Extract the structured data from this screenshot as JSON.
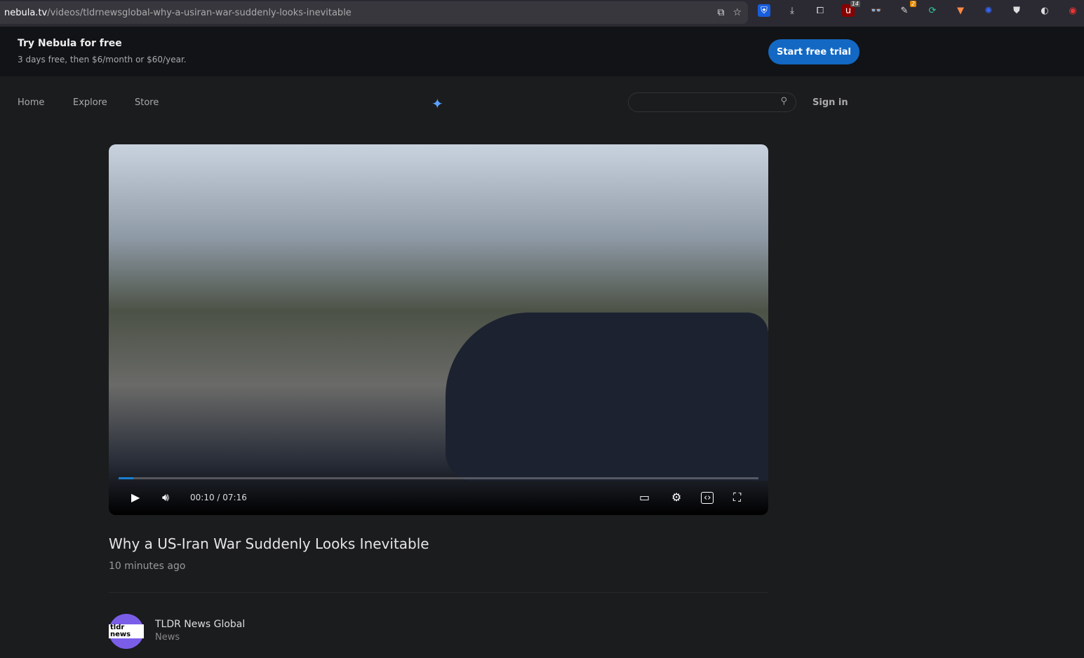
{
  "browser": {
    "url_host": "nebula.tv",
    "url_path": "/videos/tldrnewsglobal-why-a-usiran-war-suddenly-looks-inevitable",
    "badges": [
      "14",
      "2"
    ]
  },
  "promo": {
    "title": "Try Nebula for free",
    "subtitle": "3 days free, then $6/month or $60/year.",
    "cta": "Start free trial"
  },
  "nav": {
    "items": [
      "Home",
      "Explore",
      "Store"
    ],
    "search_placeholder": "",
    "sign_in": "Sign in"
  },
  "player": {
    "current": "00:10",
    "duration": "07:16",
    "time_label": "00:10 / 07:16",
    "progress_percent": 2.3
  },
  "video": {
    "title": "Why a US-Iran War Suddenly Looks Inevitable",
    "posted": "10 minutes ago"
  },
  "channel": {
    "name": "TLDR News Global",
    "category": "News",
    "avatar_text": "tldr news"
  },
  "colors": {
    "accent": "#1368c4",
    "link": "#3aa0f0"
  }
}
